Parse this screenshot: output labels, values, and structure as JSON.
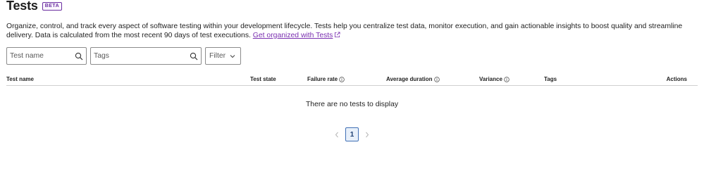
{
  "header": {
    "title": "Tests",
    "badge": "BETA"
  },
  "description": {
    "text": "Organize, control, and track every aspect of software testing within your development lifecycle. Tests help you centralize test data, monitor execution, and gain actionable insights to boost quality and streamline delivery. Data is calculated from the most recent 90 days of test executions. ",
    "link_label": "Get organized with Tests"
  },
  "filters": {
    "name_placeholder": "Test name",
    "tags_placeholder": "Tags",
    "filter_label": "Filter"
  },
  "table": {
    "columns": {
      "test_name": "Test name",
      "test_state": "Test state",
      "failure_rate": "Failure rate",
      "average_duration": "Average duration",
      "variance": "Variance",
      "tags": "Tags",
      "actions": "Actions"
    },
    "empty_message": "There are no tests to display"
  },
  "pagination": {
    "current_page": "1"
  },
  "colors": {
    "link": "#7a2fb0",
    "badge": "#6b2fa0",
    "pager_active": "#3f6fb5"
  }
}
